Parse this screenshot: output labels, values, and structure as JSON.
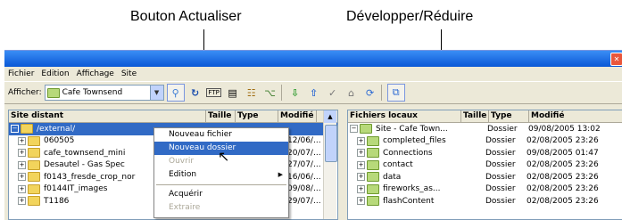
{
  "callouts": {
    "refresh": "Bouton Actualiser",
    "expand": "Développer/Réduire"
  },
  "titlebar": {
    "close_icon": "close-icon"
  },
  "menubar": [
    "Fichier",
    "Edition",
    "Affichage",
    "Site"
  ],
  "toolbar": {
    "show_label": "Afficher:",
    "site_value": "Cafe Townsend",
    "icons": [
      "connect-icon",
      "refresh-icon",
      "ftp-log-icon",
      "view-icon",
      "site-files-icon",
      "site-map-icon",
      "get-icon",
      "put-icon",
      "check-out-icon",
      "check-in-icon",
      "synchronize-icon",
      "expand-collapse-icon"
    ]
  },
  "remote": {
    "headers": {
      "name": "Site distant",
      "size": "Taille",
      "type": "Type",
      "modified": "Modifié"
    },
    "root": "/external/",
    "rows": [
      {
        "name": "060505",
        "modified": "12/06/..."
      },
      {
        "name": "cafe_townsend_mini",
        "modified": "20/07/..."
      },
      {
        "name": "Desautel - Gas Spec",
        "modified": "27/07/..."
      },
      {
        "name": "f0143_fresde_crop_nor",
        "modified": "16/06/..."
      },
      {
        "name": "f0144IT_images",
        "modified": "09/08/..."
      },
      {
        "name": "T1186",
        "modified": "29/07/..."
      }
    ]
  },
  "context_menu": {
    "items": [
      "Nouveau fichier",
      "Nouveau dossier",
      "Ouvrir",
      "Edition",
      "Acquérir",
      "Extraire"
    ],
    "highlighted_index": 1,
    "disabled": [
      "Ouvrir",
      "Extraire"
    ]
  },
  "local": {
    "headers": {
      "name": "Fichiers locaux",
      "size": "Taille",
      "type": "Type",
      "modified": "Modifié"
    },
    "root": {
      "name": "Site - Cafe Town...",
      "type": "Dossier",
      "modified": "09/08/2005 13:02"
    },
    "rows": [
      {
        "name": "completed_files",
        "type": "Dossier",
        "modified": "02/08/2005 23:26"
      },
      {
        "name": "Connections",
        "type": "Dossier",
        "modified": "09/08/2005 01:47"
      },
      {
        "name": "contact",
        "type": "Dossier",
        "modified": "02/08/2005 23:26"
      },
      {
        "name": "data",
        "type": "Dossier",
        "modified": "02/08/2005 23:26"
      },
      {
        "name": "fireworks_as...",
        "type": "Dossier",
        "modified": "02/08/2005 23:26"
      },
      {
        "name": "flashContent",
        "type": "Dossier",
        "modified": "02/08/2005 23:26"
      }
    ]
  }
}
